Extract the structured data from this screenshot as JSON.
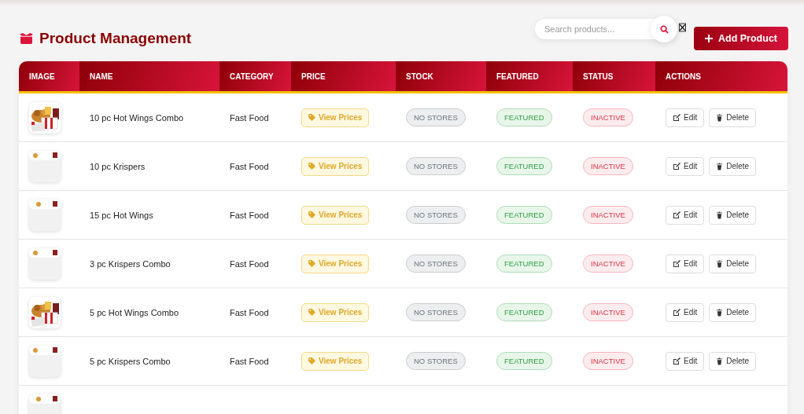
{
  "page": {
    "title": "Product Management"
  },
  "search": {
    "placeholder": "Search products..."
  },
  "add_button": {
    "label": "Add Product"
  },
  "table": {
    "columns": [
      "IMAGE",
      "NAME",
      "CATEGORY",
      "PRICE",
      "STOCK",
      "FEATURED",
      "STATUS",
      "ACTIONS"
    ],
    "rows": [
      {
        "kind": "product",
        "name": "10 pc Hot Wings Combo",
        "category": "Fast Food",
        "price": "View Prices",
        "stock": "NO STORES",
        "featured": "FEATURED",
        "is_featured": true,
        "status": "INACTIVE",
        "active": false,
        "edit": "Edit",
        "delete": "Delete"
      },
      {
        "kind": "product",
        "name": "10 pc Krispers",
        "category": "Fast Food",
        "price": "View Prices",
        "stock": "NO STORES",
        "featured": "FEATURED",
        "is_featured": true,
        "status": "INACTIVE",
        "active": false,
        "edit": "Edit",
        "delete": "Delete"
      },
      {
        "kind": "product",
        "name": "15 pc Hot Wings",
        "category": "Fast Food",
        "price": "View Prices",
        "stock": "NO STORES",
        "featured": "FEATURED",
        "is_featured": true,
        "status": "INACTIVE",
        "active": false,
        "edit": "Edit",
        "delete": "Delete"
      },
      {
        "kind": "product",
        "name": "3 pc Krispers Combo",
        "category": "Fast Food",
        "price": "View Prices",
        "stock": "NO STORES",
        "featured": "FEATURED",
        "is_featured": true,
        "status": "INACTIVE",
        "active": false,
        "edit": "Edit",
        "delete": "Delete"
      },
      {
        "kind": "product",
        "name": "5 pc Hot Wings Combo",
        "category": "Fast Food",
        "price": "View Prices",
        "stock": "NO STORES",
        "featured": "FEATURED",
        "is_featured": true,
        "status": "INACTIVE",
        "active": false,
        "edit": "Edit",
        "delete": "Delete"
      },
      {
        "kind": "product",
        "name": "5 pc Krispers Combo",
        "category": "Fast Food",
        "price": "View Prices",
        "stock": "NO STORES",
        "featured": "FEATURED",
        "is_featured": true,
        "status": "INACTIVE",
        "active": false,
        "edit": "Edit",
        "delete": "Delete"
      },
      {
        "kind": "partial"
      }
    ]
  }
}
